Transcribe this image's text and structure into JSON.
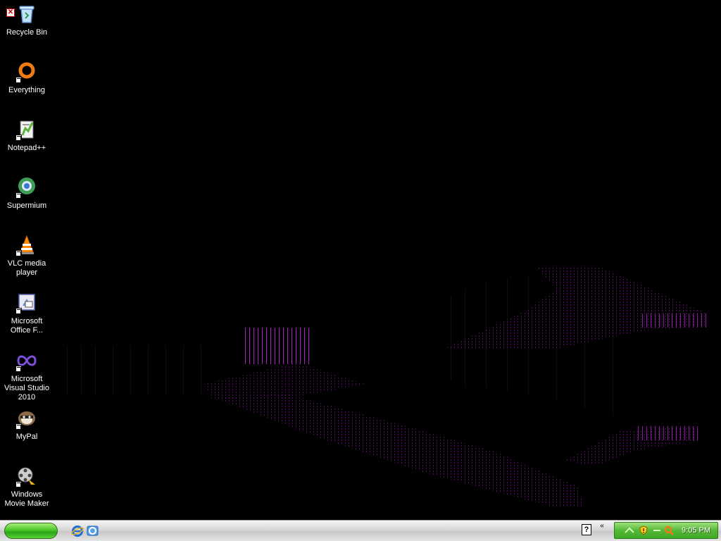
{
  "desktop": {
    "icons": [
      {
        "label": "Recycle Bin",
        "icon": "recycle-bin-icon"
      },
      {
        "label": "Everything",
        "icon": "everything-icon"
      },
      {
        "label": "Notepad++",
        "icon": "notepadpp-icon"
      },
      {
        "label": "Supermium",
        "icon": "supermium-icon"
      },
      {
        "label": "VLC media player",
        "icon": "vlc-icon"
      },
      {
        "label": "Microsoft Office F...",
        "icon": "office-icon"
      },
      {
        "label": "Microsoft Visual Studio 2010",
        "icon": "visual-studio-icon"
      },
      {
        "label": "MyPal",
        "icon": "mypal-icon"
      },
      {
        "label": "Windows Movie Maker",
        "icon": "movie-maker-icon"
      }
    ],
    "recycle_error_symbol": "✕"
  },
  "taskbar": {
    "quick_launch": [
      {
        "icon": "internet-explorer-icon"
      },
      {
        "icon": "show-desktop-icon"
      }
    ],
    "help_symbol": "?",
    "tray_expand_symbol": "«",
    "clock": "9:05 PM"
  },
  "colors": {
    "desktop_bg": "#000000",
    "art_magenta": "#b01ec8",
    "taskbar_bg": "#d7d7d7",
    "start_green": "#3fb51f",
    "tray_green": "#54b836"
  }
}
